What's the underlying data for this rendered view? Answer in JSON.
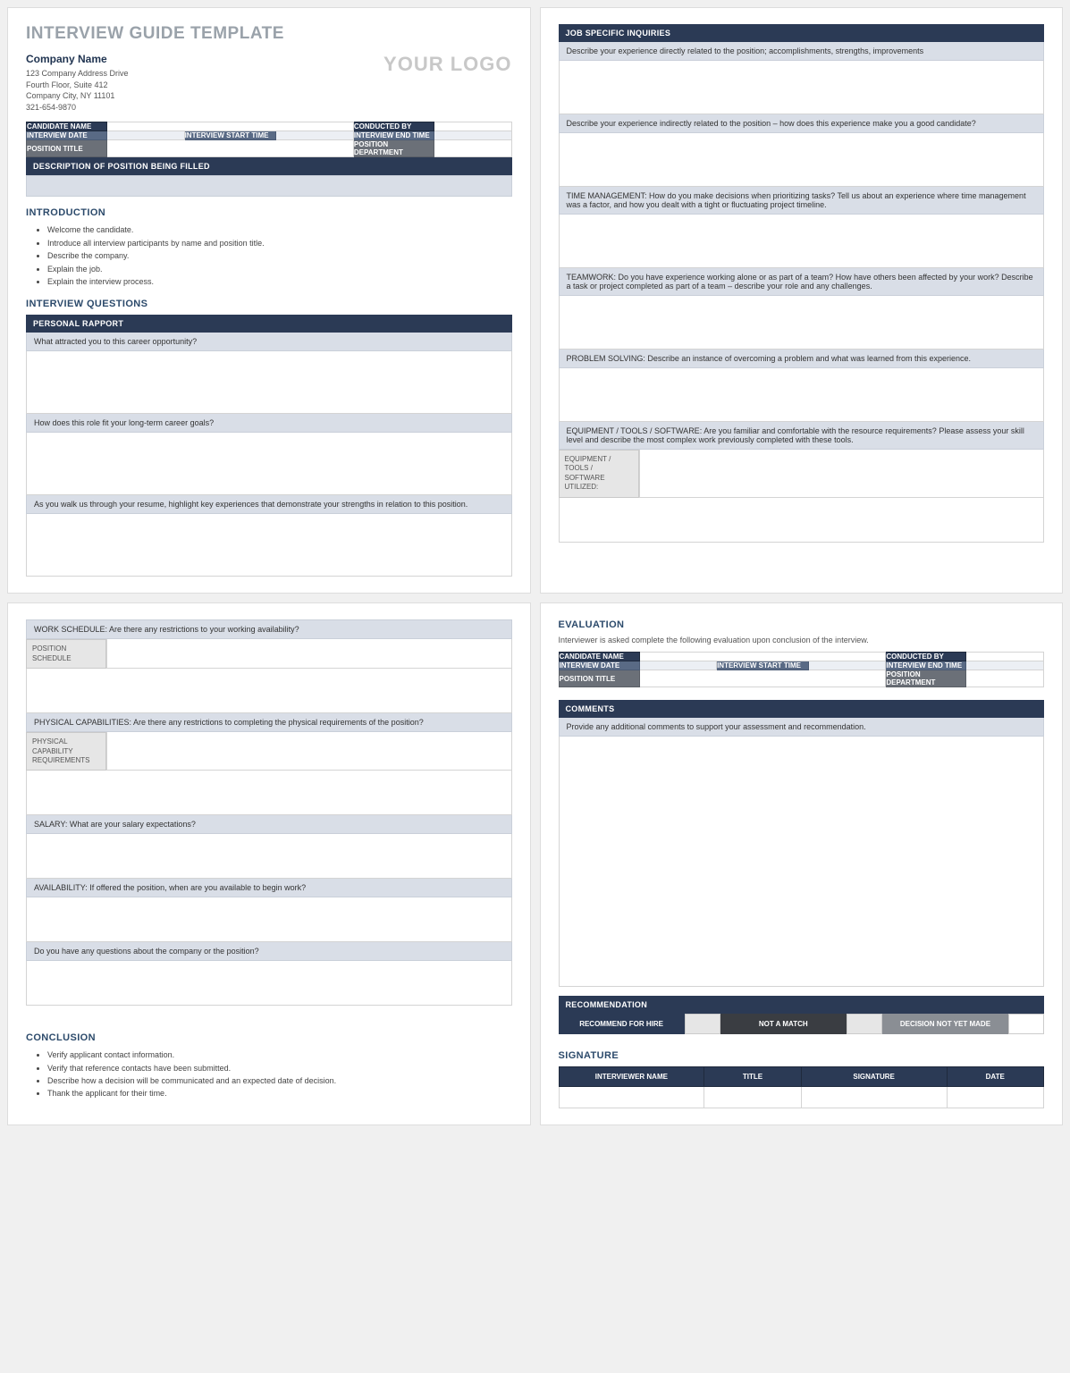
{
  "doc": {
    "title": "INTERVIEW GUIDE TEMPLATE",
    "company_name": "Company Name",
    "address_line1": "123 Company Address Drive",
    "address_line2": "Fourth Floor, Suite 412",
    "address_line3": "Company City, NY  11101",
    "phone": "321-654-9870",
    "logo_text": "YOUR LOGO"
  },
  "info_labels": {
    "candidate_name": "CANDIDATE NAME",
    "conducted_by": "CONDUCTED BY",
    "interview_date": "INTERVIEW DATE",
    "interview_start": "INTERVIEW START TIME",
    "interview_end": "INTERVIEW END TIME",
    "position_title": "POSITION TITLE",
    "position_dept": "POSITION DEPARTMENT",
    "description_bar": "DESCRIPTION OF POSITION BEING FILLED"
  },
  "sections": {
    "introduction": "INTRODUCTION",
    "interview_questions": "INTERVIEW QUESTIONS",
    "conclusion": "CONCLUSION",
    "evaluation": "EVALUATION",
    "comments": "COMMENTS",
    "recommendation": "RECOMMENDATION",
    "signature": "SIGNATURE"
  },
  "intro_bullets": [
    "Welcome the candidate.",
    "Introduce all interview participants by name and position title.",
    "Describe the company.",
    "Explain the job.",
    "Explain the interview process."
  ],
  "conclusion_bullets": [
    "Verify applicant contact information.",
    "Verify that reference contacts have been submitted.",
    "Describe how a decision will be communicated and an expected date of decision.",
    "Thank the applicant for their time."
  ],
  "personal_rapport": {
    "header": "PERSONAL RAPPORT",
    "q1": "What attracted you to this career opportunity?",
    "q2": "How does this role fit your long-term career goals?",
    "q3": "As you walk us through your resume, highlight key experiences that demonstrate your strengths in relation to this position."
  },
  "job_specific": {
    "header": "JOB SPECIFIC INQUIRIES",
    "q1": "Describe your experience directly related to the position; accomplishments, strengths, improvements",
    "q2": "Describe your experience indirectly related to the position – how does this experience make you a good candidate?",
    "q3": "TIME MANAGEMENT: How do you make decisions when prioritizing tasks? Tell us about an experience where time management was a factor, and how you dealt with a tight or fluctuating project timeline.",
    "q4": "TEAMWORK: Do you have experience working alone or as part of a team? How have others been affected by your work? Describe a task or project completed as part of a team – describe your role and any challenges.",
    "q5": "PROBLEM SOLVING: Describe an instance of overcoming a problem and what was learned from this experience.",
    "q6": "EQUIPMENT / TOOLS / SOFTWARE: Are you familiar and comfortable with the resource requirements? Please assess your skill level and describe the most complex work previously completed with these tools.",
    "q6_sub": "EQUIPMENT / TOOLS / SOFTWARE UTILIZED:"
  },
  "page3": {
    "work_schedule": "WORK SCHEDULE: Are there any restrictions to your working availability?",
    "work_schedule_sub": "POSITION SCHEDULE",
    "physical": "PHYSICAL CAPABILITIES: Are there any restrictions to completing the physical requirements of the position?",
    "physical_sub": "PHYSICAL CAPABILITY REQUIREMENTS",
    "salary": "SALARY: What are your salary expectations?",
    "availability": "AVAILABILITY:  If offered the position, when are you available to begin work?",
    "questions": "Do you have any questions about the company or the position?"
  },
  "evaluation": {
    "instruction": "Interviewer is asked complete the following evaluation upon conclusion of the interview.",
    "comments_prompt": "Provide any additional comments to support your assessment and recommendation."
  },
  "recommendation_options": {
    "hire": "RECOMMEND FOR HIRE",
    "not_match": "NOT A MATCH",
    "undecided": "DECISION NOT YET MADE"
  },
  "signature_headers": {
    "name": "INTERVIEWER NAME",
    "title": "TITLE",
    "signature": "SIGNATURE",
    "date": "DATE"
  }
}
